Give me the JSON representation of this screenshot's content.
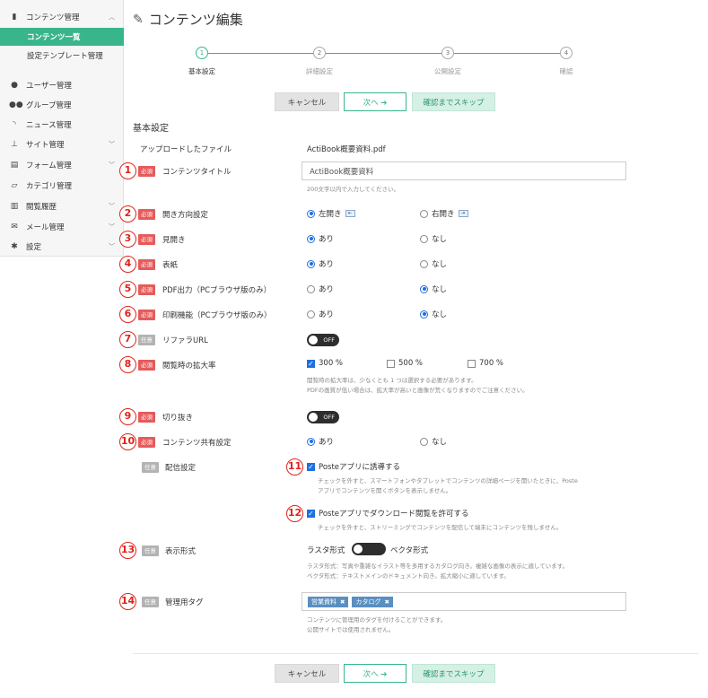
{
  "sidebar": {
    "content_management": "コンテンツ管理",
    "content_list": "コンテンツ一覧",
    "template_management": "設定テンプレート管理",
    "user_management": "ユーザー管理",
    "group_management": "グループ管理",
    "news_management": "ニュース管理",
    "site_management": "サイト管理",
    "form_management": "フォーム管理",
    "category_management": "カテゴリ管理",
    "view_history": "閲覧履歴",
    "mail_management": "メール管理",
    "settings": "設定"
  },
  "page_title": "コンテンツ編集",
  "steps": [
    {
      "num": "1",
      "label": "基本設定"
    },
    {
      "num": "2",
      "label": "詳細設定"
    },
    {
      "num": "3",
      "label": "公開設定"
    },
    {
      "num": "4",
      "label": "確認"
    }
  ],
  "buttons": {
    "cancel": "キャンセル",
    "next": "次へ ➔",
    "skip": "確認までスキップ"
  },
  "section_title": "基本設定",
  "badges": {
    "required": "必須",
    "optional": "任意"
  },
  "fields": {
    "uploaded_file": {
      "label": "アップロードしたファイル",
      "value": "ActiBook概要資料.pdf"
    },
    "title": {
      "num": "1",
      "label": "コンテンツタイトル",
      "value": "ActiBook概要資料",
      "help": "200文字以内で入力してください。"
    },
    "open_direction": {
      "num": "2",
      "label": "開き方向設定",
      "left": "左開き",
      "right": "右開き",
      "selected": "left"
    },
    "spread": {
      "num": "3",
      "label": "見開き",
      "yes": "あり",
      "no": "なし",
      "selected": "yes"
    },
    "cover": {
      "num": "4",
      "label": "表紙",
      "yes": "あり",
      "no": "なし",
      "selected": "yes"
    },
    "pdf_output": {
      "num": "5",
      "label": "PDF出力（PCブラウザ版のみ）",
      "yes": "あり",
      "no": "なし",
      "selected": "no"
    },
    "print": {
      "num": "6",
      "label": "印刷機能（PCブラウザ版のみ）",
      "yes": "あり",
      "no": "なし",
      "selected": "no"
    },
    "referrer": {
      "num": "7",
      "label": "リファラURL",
      "toggle": "OFF"
    },
    "zoom": {
      "num": "8",
      "label": "閲覧時の拡大率",
      "options": [
        "300 %",
        "500 %",
        "700 %"
      ],
      "checked": [
        "300 %"
      ],
      "help1": "閲覧時の拡大率は、少なくとも 1 つは選択する必要があります。",
      "help2": "PDFの画質が低い場合は、拡大率が高いと画像が荒くなりますのでご注意ください。"
    },
    "crop": {
      "num": "9",
      "label": "切り抜き",
      "toggle": "OFF"
    },
    "share": {
      "num": "10",
      "label": "コンテンツ共有設定",
      "yes": "あり",
      "no": "なし",
      "selected": "yes"
    },
    "delivery": {
      "label": "配信設定",
      "opt1": {
        "num": "11",
        "label": "Posteアプリに誘導する",
        "help1": "チェックを外すと、スマートフォンやタブレットでコンテンツの詳細ページを開いたときに、Poste",
        "help2": "アプリでコンテンツを開くボタンを表示しません。"
      },
      "opt2": {
        "num": "12",
        "label": "Posteアプリでダウンロード閲覧を許可する",
        "help1": "チェックを外すと、ストリーミングでコンテンツを配信して端末にコンテンツを残しません。"
      }
    },
    "display_format": {
      "num": "13",
      "label": "表示形式",
      "raster": "ラスタ形式",
      "vector": "ベクタ形式",
      "help1": "ラスタ形式：写真や重雑なイラスト等を多用するカタログ向き。複雑な画像の表示に適しています。",
      "help2": "ベクタ形式：テキストメインのドキュメント向き。拡大縮小に適しています。"
    },
    "tags": {
      "num": "14",
      "label": "管理用タグ",
      "values": [
        "営業資料",
        "カタログ"
      ],
      "help1": "コンテンツに管理用のタグを付けることができます。",
      "help2": "公開サイトでは使用されません。"
    }
  },
  "colors": {
    "accent": "#39b58c",
    "required": "#e55b5b",
    "number_circle": "#e1231a",
    "check": "#1f6fe0",
    "tag": "#5a8fc2"
  }
}
